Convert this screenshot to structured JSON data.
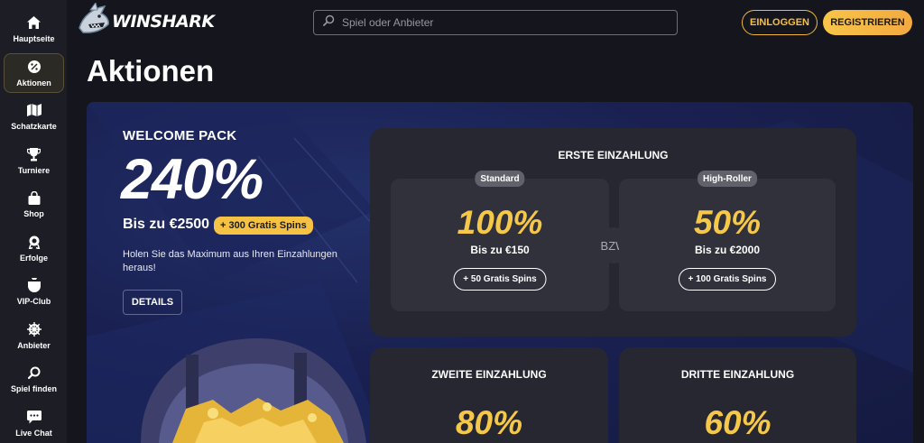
{
  "sidebar": {
    "items": [
      {
        "label": "Hauptseite",
        "icon": "home-icon"
      },
      {
        "label": "Aktionen",
        "icon": "percent-icon"
      },
      {
        "label": "Schatzkarte",
        "icon": "map-icon"
      },
      {
        "label": "Turniere",
        "icon": "trophy-icon"
      },
      {
        "label": "Shop",
        "icon": "shopping-bag-icon"
      },
      {
        "label": "Erfolge",
        "icon": "badge-icon"
      },
      {
        "label": "VIP-Club",
        "icon": "vip-crest-icon"
      },
      {
        "label": "Anbieter",
        "icon": "ship-wheel-icon"
      },
      {
        "label": "Spiel finden",
        "icon": "search-icon"
      },
      {
        "label": "Live Chat",
        "icon": "chat-icon"
      }
    ]
  },
  "header": {
    "brand": "WINSHARK",
    "search_placeholder": "Spiel oder Anbieter",
    "login_label": "EINLOGGEN",
    "register_label": "REGISTRIEREN"
  },
  "page": {
    "title": "Aktionen"
  },
  "welcome": {
    "title": "WELCOME PACK",
    "percent": "240%",
    "upto": "Bis zu €2500",
    "spins_badge": "+ 300 Gratis Spins",
    "description": "Holen Sie das Maximum aus Ihren Einzahlungen heraus!",
    "details_label": "DETAILS"
  },
  "first_deposit": {
    "title": "ERSTE EINZAHLUNG",
    "separator": "BZW",
    "standard": {
      "tag": "Standard",
      "percent": "100%",
      "upto": "Bis zu €150",
      "spins": "+ 50 Gratis Spins"
    },
    "highroller": {
      "tag": "High-Roller",
      "percent": "50%",
      "upto": "Bis zu €2000",
      "spins": "+ 100 Gratis Spins"
    }
  },
  "second_deposit": {
    "title": "ZWEITE EINZAHLUNG",
    "percent": "80%"
  },
  "third_deposit": {
    "title": "DRITTE EINZAHLUNG",
    "percent": "60%"
  },
  "colors": {
    "accent": "#f6c84a",
    "background": "#15161d",
    "sidebar": "#1c1d25",
    "card": "#262730"
  }
}
